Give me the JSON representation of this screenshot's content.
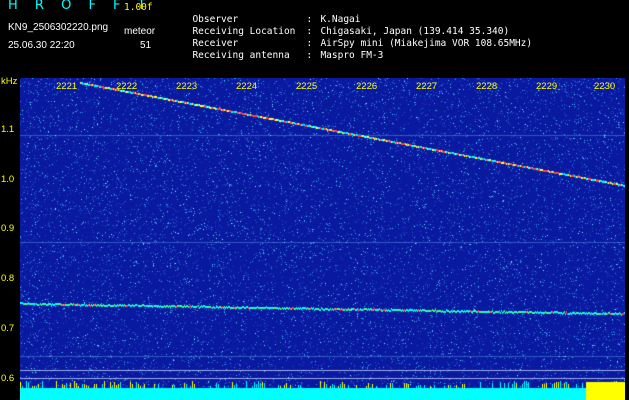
{
  "header": {
    "logo": "H R O F F T",
    "version": "1.00f",
    "filename": "KN9_2506302220.png",
    "meteor_label": "meteor",
    "datetime": "25.06.30 22:20",
    "meteor_count": "51"
  },
  "info": [
    {
      "key": "Observer",
      "sep": ":",
      "value": "K.Nagai"
    },
    {
      "key": "Receiving Location",
      "sep": ":",
      "value": "Chigasaki, Japan (139.414 35.340)"
    },
    {
      "key": "Receiver",
      "sep": ":",
      "value": "AirSpy mini (Miakejima VOR 108.65MHz)"
    },
    {
      "key": "Receiving antenna",
      "sep": ":",
      "value": "Maspro FM-3"
    }
  ],
  "chart_data": {
    "type": "heatmap",
    "ylabel": "kHz",
    "yticks": [
      "1.1",
      "1.0",
      "0.9",
      "0.8",
      "0.7",
      "0.6"
    ],
    "xticks": [
      "2221",
      "2222",
      "2223",
      "2224",
      "2225",
      "2226",
      "2227",
      "2228",
      "2229",
      "2230"
    ],
    "ylim": [
      0.58,
      1.2
    ],
    "colors": {
      "background": "#0a1aa0",
      "noise": "#2f8fe0",
      "signal": "#00ffff",
      "hot": "#ff4040"
    }
  }
}
